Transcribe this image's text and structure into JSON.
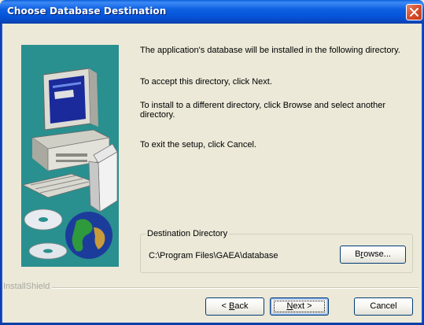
{
  "window": {
    "title": "Choose Database Destination"
  },
  "instructions": {
    "line1": "The application's database will be installed in the following directory.",
    "line2": "To accept this directory, click Next.",
    "line3": "To install to a different directory, click Browse and select another directory.",
    "line4": "To exit the setup,  click Cancel."
  },
  "destination": {
    "legend": "Destination Directory",
    "path": "C:\\Program Files\\GAEA\\database",
    "browse_pre": "B",
    "browse_mn": "r",
    "browse_post": "owse..."
  },
  "footer": {
    "brand": "InstallShield",
    "back_pre": "< ",
    "back_mn": "B",
    "back_post": "ack",
    "next_mn": "N",
    "next_post": "ext >",
    "cancel": "Cancel"
  },
  "colors": {
    "titlebar": "#0a5fd8",
    "art_background": "#2a8f8f",
    "dialog_background": "#ece9d8"
  }
}
